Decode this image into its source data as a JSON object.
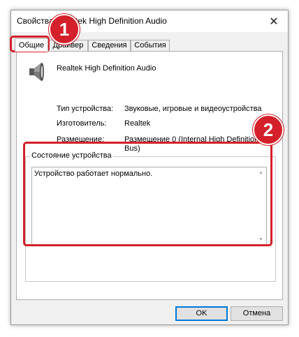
{
  "window": {
    "title": "Свойства: Realtek High Definition Audio"
  },
  "tabs": [
    {
      "label": "Общие"
    },
    {
      "label": "Драйвер"
    },
    {
      "label": "Сведения"
    },
    {
      "label": "События"
    }
  ],
  "device": {
    "icon": "speaker-icon",
    "name": "Realtek High Definition Audio"
  },
  "properties": {
    "type_label": "Тип устройства:",
    "type_value": "Звуковые, игровые и видеоустройства",
    "manufacturer_label": "Изготовитель:",
    "manufacturer_value": "Realtek",
    "location_label": "Размещение:",
    "location_value": "Размещение 0 (Internal High Definition Audio Bus)"
  },
  "status": {
    "group_label": "Состояние устройства",
    "text": "Устройство работает нормально."
  },
  "buttons": {
    "ok": "OK",
    "cancel": "Отмена"
  },
  "annotations": {
    "badge1": "1",
    "badge2": "2",
    "color": "#d4202a"
  }
}
